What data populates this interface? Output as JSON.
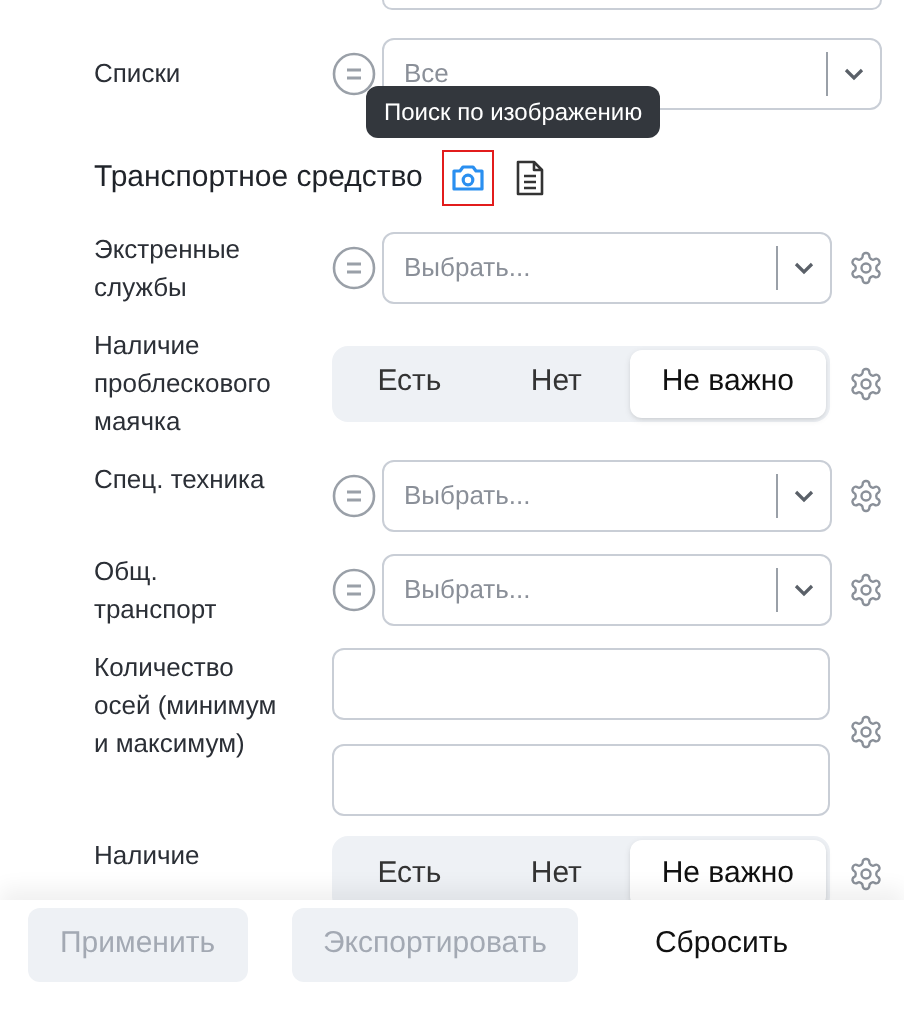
{
  "lists_filter": {
    "label": "Списки",
    "value": "Все"
  },
  "section": {
    "title": "Транспортное средство",
    "tooltip": "Поиск по изображению",
    "camera_highlighted": true
  },
  "filters": [
    {
      "kind": "select",
      "label": "Экстренные службы",
      "placeholder": "Выбрать..."
    },
    {
      "kind": "segmented",
      "label": "Наличие проблескового маячка",
      "options": [
        {
          "label": "Есть",
          "selected": false
        },
        {
          "label": "Нет",
          "selected": false
        },
        {
          "label": "Не важно",
          "selected": true
        }
      ]
    },
    {
      "kind": "select",
      "label": "Спец. техника",
      "placeholder": "Выбрать..."
    },
    {
      "kind": "select",
      "label": "Общ. транспорт",
      "placeholder": "Выбрать..."
    },
    {
      "kind": "range",
      "label": "Количество осей (минимум и максимум)"
    },
    {
      "kind": "segmented",
      "label": "Наличие",
      "options": [
        {
          "label": "Есть",
          "selected": false
        },
        {
          "label": "Нет",
          "selected": false
        },
        {
          "label": "Не важно",
          "selected": true
        }
      ]
    }
  ],
  "buttons": [
    {
      "label": "Применить",
      "disabled": true
    },
    {
      "label": "Экспортировать",
      "disabled": true
    },
    {
      "label": "Сбросить",
      "disabled": false
    }
  ]
}
